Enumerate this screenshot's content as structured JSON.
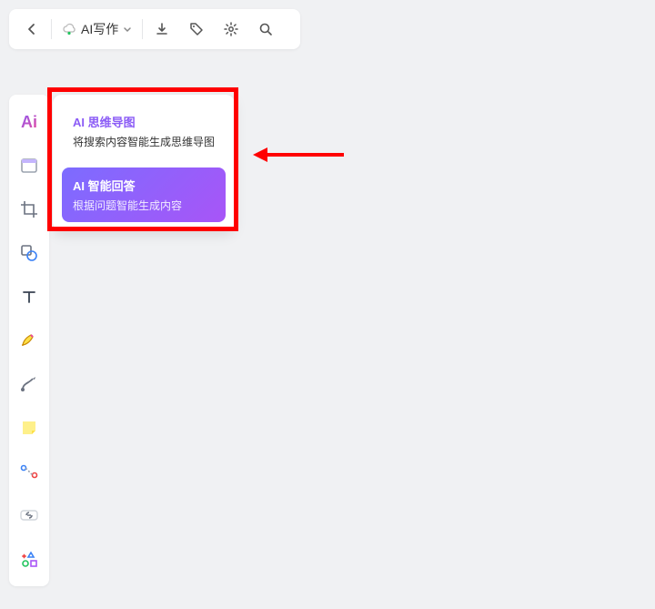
{
  "topbar": {
    "ai_dropdown_label": "AI写作"
  },
  "popover": {
    "mindmap": {
      "title": "AI 思维导图",
      "desc": "将搜索内容智能生成思维导图"
    },
    "answer": {
      "title": "AI 智能回答",
      "desc": "根据问题智能生成内容"
    }
  },
  "sidebar": {
    "ai_label": "Ai"
  }
}
